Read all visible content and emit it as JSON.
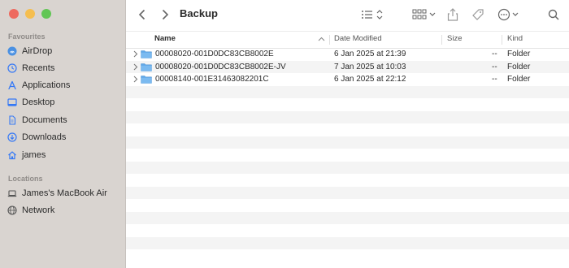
{
  "window": {
    "title": "Backup",
    "traffic_colors": [
      "#ee6a5f",
      "#f5be4f",
      "#62c655"
    ]
  },
  "sidebar": {
    "favourites_title": "Favourites",
    "favourites": [
      {
        "label": "AirDrop",
        "icon": "airdrop-icon"
      },
      {
        "label": "Recents",
        "icon": "clock-icon"
      },
      {
        "label": "Applications",
        "icon": "applications-icon"
      },
      {
        "label": "Desktop",
        "icon": "desktop-icon"
      },
      {
        "label": "Documents",
        "icon": "document-icon"
      },
      {
        "label": "Downloads",
        "icon": "download-icon"
      },
      {
        "label": "james",
        "icon": "home-icon"
      }
    ],
    "locations_title": "Locations",
    "locations": [
      {
        "label": "James's MacBook Air",
        "icon": "laptop-icon"
      },
      {
        "label": "Network",
        "icon": "network-icon"
      }
    ]
  },
  "columns": {
    "name": "Name",
    "date": "Date Modified",
    "size": "Size",
    "kind": "Kind"
  },
  "files": [
    {
      "name": "00008020-001D0DC83CB8002E",
      "date": "6 Jan 2025 at 21:39",
      "size": "--",
      "kind": "Folder"
    },
    {
      "name": "00008020-001D0DC83CB8002E-JV",
      "date": "7 Jan 2025 at 10:03",
      "size": "--",
      "kind": "Folder"
    },
    {
      "name": "00008140-001E31463082201C",
      "date": "6 Jan 2025 at 22:12",
      "size": "--",
      "kind": "Folder"
    }
  ],
  "accent_color": "#3478f6",
  "folder_color": "#62a9e8"
}
